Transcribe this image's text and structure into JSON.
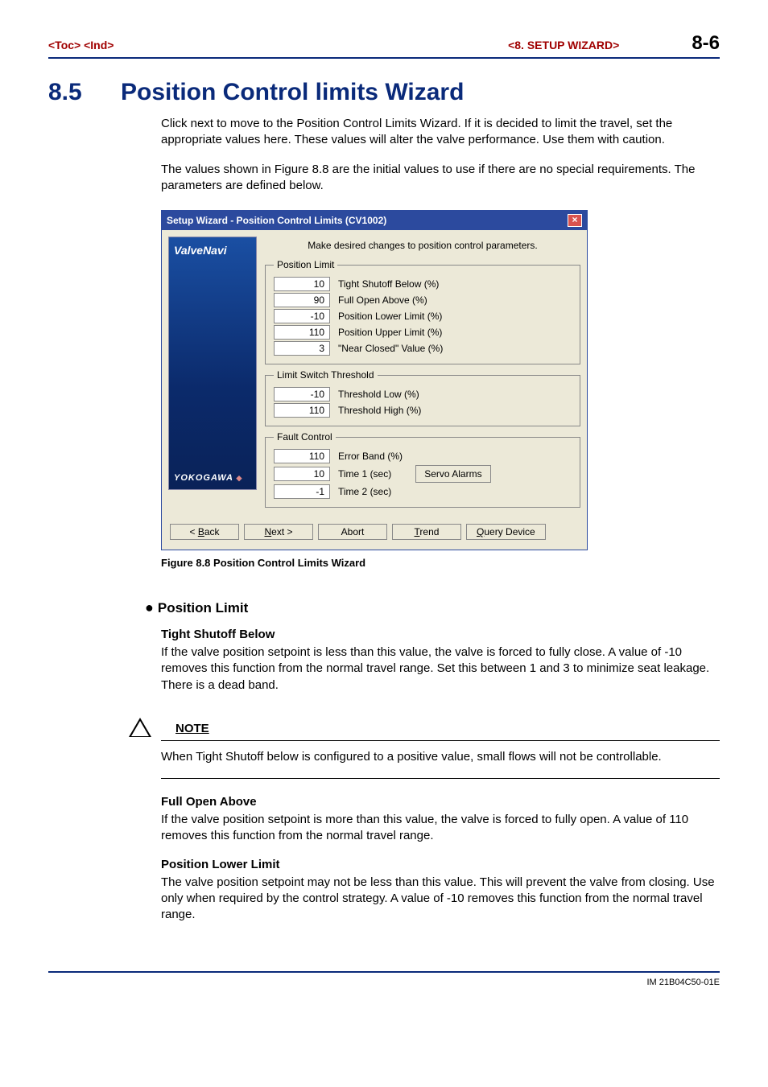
{
  "header": {
    "left": "<Toc> <Ind>",
    "right": "<8.  SETUP WIZARD>",
    "page": "8-6"
  },
  "section": {
    "num": "8.5",
    "title": "Position Control limits Wizard"
  },
  "para1": "Click next to move to the Position Control Limits Wizard.  If it is decided to limit the travel, set the appropriate values here.  These values will alter the valve performance.  Use them with caution.",
  "para2": "The values shown in Figure 8.8 are the initial values to use if there are no special requirements.  The parameters are defined below.",
  "dialog": {
    "title": "Setup Wizard - Position Control Limits (CV1002)",
    "instruction": "Make desired changes to position control parameters.",
    "brand_top": "ValveNavi",
    "brand_bottom": "YOKOGAWA",
    "groups": {
      "position_limit": {
        "legend": "Position Limit",
        "fields": [
          {
            "value": "10",
            "label": "Tight Shutoff Below (%)"
          },
          {
            "value": "90",
            "label": "Full Open Above (%)"
          },
          {
            "value": "-10",
            "label": "Position Lower Limit (%)"
          },
          {
            "value": "110",
            "label": "Position Upper Limit (%)"
          },
          {
            "value": "3",
            "label": "\"Near Closed\" Value (%)"
          }
        ]
      },
      "limit_switch": {
        "legend": "Limit Switch Threshold",
        "fields": [
          {
            "value": "-10",
            "label": "Threshold Low (%)"
          },
          {
            "value": "110",
            "label": "Threshold High (%)"
          }
        ]
      },
      "fault_control": {
        "legend": "Fault Control",
        "fields": [
          {
            "value": "110",
            "label": "Error Band (%)"
          },
          {
            "value": "10",
            "label": "Time 1 (sec)"
          },
          {
            "value": "-1",
            "label": "Time 2 (sec)"
          }
        ],
        "button": "Servo Alarms"
      }
    },
    "buttons": {
      "back": "< Back",
      "next": "Next >",
      "abort": "Abort",
      "trend": "Trend",
      "query": "Query Device"
    }
  },
  "figure_caption": "Figure 8.8 Position Control Limits Wizard",
  "subsection": {
    "heading": "Position Limit",
    "tight_shutoff": {
      "title": "Tight Shutoff Below",
      "text": "If the valve position setpoint is less than this value, the valve is forced to fully close.  A value of -10 removes this function from the normal travel range.  Set this between 1 and 3 to minimize seat leakage.  There is a dead band."
    },
    "note": {
      "label": "NOTE",
      "text": "When Tight Shutoff below is configured to a positive value, small flows will not be controllable."
    },
    "full_open": {
      "title": "Full Open Above",
      "text": "If the valve position setpoint is more than this value, the valve is forced to fully open.  A value of 110 removes this function from the normal travel range."
    },
    "lower_limit": {
      "title": "Position Lower Limit",
      "text": "The valve position setpoint may not be less than this value.  This will prevent the valve from closing.  Use only when required by the control strategy.  A value of -10 removes this function from the normal travel range."
    }
  },
  "footer": "IM 21B04C50-01E"
}
